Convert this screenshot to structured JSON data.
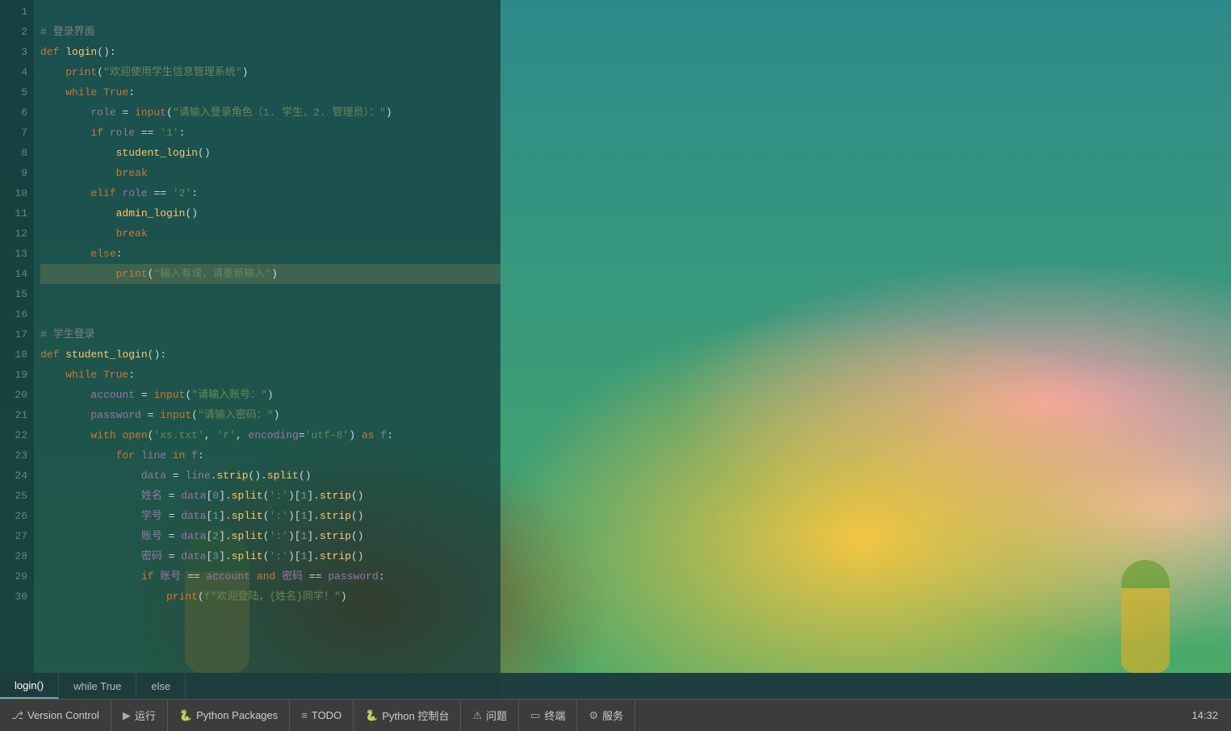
{
  "editor": {
    "lines": [
      {
        "num": "1",
        "content": "",
        "tokens": []
      },
      {
        "num": "2",
        "content": "# 登录界面",
        "type": "comment"
      },
      {
        "num": "3",
        "content": "def login():",
        "type": "def"
      },
      {
        "num": "4",
        "content": "    print(\"欢迎使用学生信息管理系统\")",
        "type": "print"
      },
      {
        "num": "5",
        "content": "    while True:",
        "type": "while"
      },
      {
        "num": "6",
        "content": "        role = input(\"请输入登录角色（1. 学生，2. 管理员）：\")",
        "type": "input"
      },
      {
        "num": "7",
        "content": "        if role == '1':",
        "type": "if"
      },
      {
        "num": "8",
        "content": "            student_login()",
        "type": "call"
      },
      {
        "num": "9",
        "content": "            break",
        "type": "break"
      },
      {
        "num": "10",
        "content": "        elif role == '2':",
        "type": "elif"
      },
      {
        "num": "11",
        "content": "            admin_login()",
        "type": "call"
      },
      {
        "num": "12",
        "content": "            break",
        "type": "break"
      },
      {
        "num": "13",
        "content": "        else:",
        "type": "else"
      },
      {
        "num": "14",
        "content": "            print(\"输入有误，请重新输入\")",
        "type": "print",
        "highlighted": true
      },
      {
        "num": "15",
        "content": "",
        "type": "empty"
      },
      {
        "num": "16",
        "content": "",
        "type": "empty"
      },
      {
        "num": "17",
        "content": "# 学生登录",
        "type": "comment"
      },
      {
        "num": "18",
        "content": "def student_login():",
        "type": "def"
      },
      {
        "num": "19",
        "content": "    while True:",
        "type": "while"
      },
      {
        "num": "20",
        "content": "        account = input(\"请输入账号：\")",
        "type": "input"
      },
      {
        "num": "21",
        "content": "        password = input(\"请输入密码：\")",
        "type": "input"
      },
      {
        "num": "22",
        "content": "        with open('xs.txt', 'r', encoding='utf-8') as f:",
        "type": "with"
      },
      {
        "num": "23",
        "content": "            for line in f:",
        "type": "for"
      },
      {
        "num": "24",
        "content": "                data = line.strip().split()",
        "type": "assign"
      },
      {
        "num": "25",
        "content": "                姓名 = data[0].split(':')[1].strip()",
        "type": "assign"
      },
      {
        "num": "26",
        "content": "                学号 = data[1].split(':')[1].strip()",
        "type": "assign"
      },
      {
        "num": "27",
        "content": "                账号 = data[2].split(':')[1].strip()",
        "type": "assign"
      },
      {
        "num": "28",
        "content": "                密码 = data[3].split(':')[1].strip()",
        "type": "assign"
      },
      {
        "num": "29",
        "content": "                if 账号 == account and 密码 == password:",
        "type": "if"
      },
      {
        "num": "30",
        "content": "                    print(f\"欢迎登陆，{姓名}同学！\")",
        "type": "print"
      }
    ]
  },
  "bottom_tabs": [
    {
      "label": "login()",
      "active": true
    },
    {
      "label": "while True",
      "active": false
    },
    {
      "label": "else",
      "active": false
    }
  ],
  "status_bar": [
    {
      "icon": "⎇",
      "label": "Version Control"
    },
    {
      "icon": "▶",
      "label": "运行"
    },
    {
      "icon": "🐍",
      "label": "Python Packages"
    },
    {
      "icon": "≡",
      "label": "TODO"
    },
    {
      "icon": "🐍",
      "label": "Python 控制台"
    },
    {
      "icon": "⚠",
      "label": "问题"
    },
    {
      "icon": "▭",
      "label": "终端"
    },
    {
      "icon": "⚙",
      "label": "服务"
    }
  ],
  "time": "14:32"
}
